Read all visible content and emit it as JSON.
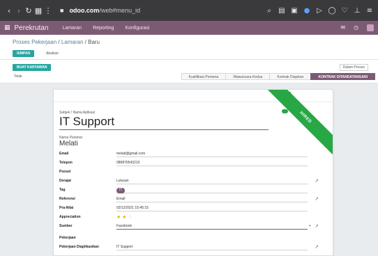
{
  "browser": {
    "url_prefix": "",
    "url_domain": "odoo.com",
    "url_suffix": "/web#menu_id",
    "icons": {
      "back": "back-arrow-icon",
      "forward": "forward-arrow-icon",
      "reload": "reload-icon",
      "lock": "lock-icon"
    }
  },
  "nav": {
    "app_name": "Perekrutan",
    "menus": [
      "Lamaran",
      "Reporting",
      "Konfigurasi"
    ]
  },
  "breadcrumb": {
    "root": "Proses Pekerjaan",
    "middle": "Lamaran",
    "current": "Baru"
  },
  "control_panel": {
    "primary_label": "SIMPAN",
    "secondary_label": "Abaikan"
  },
  "status": {
    "hired_button": "BUAT KARYAWAN",
    "refuse_button": "Tolak",
    "ongoing_button": "Dalam Proses",
    "stages": [
      "Kualifikasi Pertama",
      "Wawancara Kedua",
      "Kontrak Diajukan",
      "KONTRAK DITANDATANGANI"
    ],
    "active_stage": 3
  },
  "form": {
    "ribbon_label": "HIRED",
    "subject_label": "Subjek / Nama Aplikasi",
    "subject_value": "IT Support",
    "partner_label": "Nama Pelamar",
    "partner_value": "Melati",
    "fields": [
      {
        "label": "Email",
        "value": "melati@gmail.com",
        "ext": false
      },
      {
        "label": "Telepon",
        "value": "089876543210",
        "ext": false
      },
      {
        "label": "Ponsel",
        "value": "",
        "ext": false
      },
      {
        "label": "Derajat",
        "value": "Lulusan",
        "ext": true
      },
      {
        "label": "Tag",
        "value": "",
        "tag": "IT",
        "ext": false
      },
      {
        "label": "Referensi",
        "value": "Email",
        "ext": true
      },
      {
        "label": "Pra-Nilai",
        "value": "02/12/2021 15:45:15",
        "ext": false
      },
      {
        "label": "Appreciation",
        "value": "",
        "stars_on": 2,
        "stars_total": 3,
        "ext": false
      },
      {
        "label": "Sumber",
        "value": "Facebook",
        "ext": true,
        "caret": true
      }
    ],
    "section_label": "Pekerjaan",
    "job_field": {
      "label": "Pekerjaan Diaplikasikan",
      "value": "IT Support"
    }
  }
}
